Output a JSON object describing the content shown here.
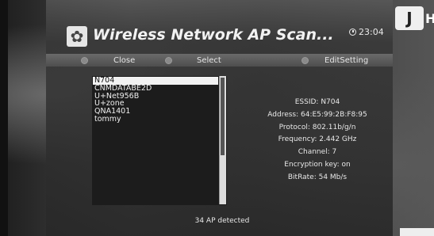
{
  "header": {
    "title": "Wireless Network AP Scan...",
    "time": "23:04",
    "icon": "gear-icon",
    "logo_letter": "H"
  },
  "buttons": {
    "close_label": "Close",
    "select_label": "Select",
    "edit_setting_label": "EditSetting"
  },
  "ap_list": {
    "items": [
      "N704",
      "CNMDATABE2D",
      "U+Net956B",
      "U+zone",
      "QNA1401",
      "tommy"
    ],
    "selected_index": 0,
    "scroll_fraction": 0.62
  },
  "details": {
    "essid": "ESSID: N704",
    "address": "Address: 64:E5:99:2B:F8:95",
    "protocol": "Protocol: 802.11b/g/n",
    "frequency": "Frequency: 2.442 GHz",
    "channel": "Channel: 7",
    "encryption": "Encryption key: on",
    "bitrate": "BitRate: 54 Mb/s"
  },
  "status": {
    "detected": "34 AP detected"
  },
  "colors": {
    "selected_bg": "#f2f2f2",
    "panel_bg": "#1c1c1c"
  }
}
